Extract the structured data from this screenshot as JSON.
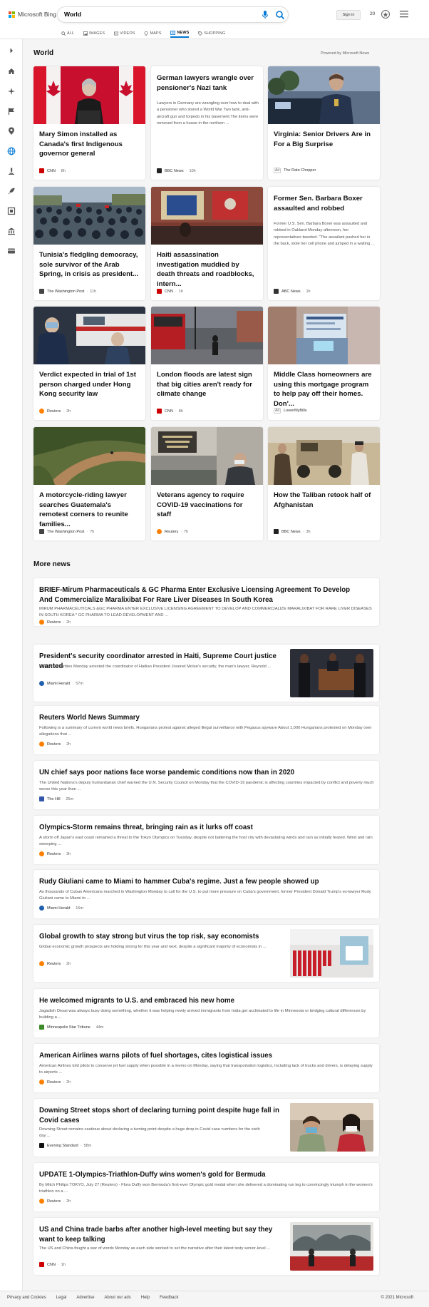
{
  "brand": {
    "name": "Microsoft Bing",
    "colors": [
      "#f25022",
      "#7fba00",
      "#00a4ef",
      "#ffb900"
    ]
  },
  "search": {
    "query": "World"
  },
  "header": {
    "sign_in": "Sign in",
    "points": "20"
  },
  "nav": [
    {
      "label": "ALL",
      "icon": "search-icon"
    },
    {
      "label": "IMAGES",
      "icon": "image-icon"
    },
    {
      "label": "VIDEOS",
      "icon": "video-icon"
    },
    {
      "label": "MAPS",
      "icon": "map-pin-icon"
    },
    {
      "label": "NEWS",
      "icon": "news-icon",
      "active": true
    },
    {
      "label": "SHOPPING",
      "icon": "tag-icon"
    }
  ],
  "main": {
    "title": "World",
    "powered": "Powered by Microsoft News"
  },
  "cards": [
    {
      "title": "Mary Simon installed as Canada's first Indigenous governor general",
      "source": "CNN",
      "time": "8h",
      "logo": "#cc0000",
      "img": "canada"
    },
    {
      "title": "German lawyers wrangle over pensioner's Nazi tank",
      "snippet": "Lawyers in Germany are wrangling over how to deal with a pensioner who stored a World War Two tank, anti-aircraft gun and torpedo in his basement.The items were removed from a house in the northern ...",
      "source": "BBC News",
      "time": "10h",
      "logo": "#222222"
    },
    {
      "title": "Virginia: Senior Drivers Are in For a Big Surprise",
      "source": "The Rate Chopper",
      "ad": "Ad",
      "img": "police"
    },
    {
      "title": "Tunisia's fledgling democracy, sole survivor of the Arab Spring, in crisis as president...",
      "source": "The Washington Post",
      "time": "11h",
      "logo": "#444444",
      "img": "crowd"
    },
    {
      "title": "Haiti assassination investigation muddied by death threats and roadblocks, intern...",
      "source": "CNN",
      "time": "1h",
      "logo": "#cc0000",
      "img": "haiti"
    },
    {
      "title": "Former Sen. Barbara Boxer assaulted and robbed",
      "snippet": "Former U.S. Sen. Barbara Boxer was assaulted and robbed in Oakland Monday afternoon, her representatives tweeted. \"The assailant pushed her in the back, stole her cell phone and jumped in a waiting ...",
      "source": "ABC News",
      "time": "1h",
      "logo": "#333333"
    },
    {
      "title": "Verdict expected in trial of 1st person charged under Hong Kong security law",
      "source": "Reuters",
      "time": "2h",
      "logo": "#ff8000",
      "img": "hongkong"
    },
    {
      "title": "London floods are latest sign that big cities aren't ready for climate change",
      "source": "CNN",
      "time": "8h",
      "logo": "#cc0000",
      "img": "london"
    },
    {
      "title": "Middle Class homeowners are using this mortgage program to help pay off their homes. Don'...",
      "source": "LowerMyBills",
      "ad": "Ad",
      "img": "mortgage"
    },
    {
      "title": "A motorcycle-riding lawyer searches Guatemala's remotest corners to reunite families...",
      "source": "The Washington Post",
      "time": "7h",
      "logo": "#444444",
      "img": "guatemala"
    },
    {
      "title": "Veterans agency to require COVID-19 vaccinations for staff",
      "source": "Reuters",
      "time": "7h",
      "logo": "#ff8000",
      "img": "veterans"
    },
    {
      "title": "How the Taliban retook half of Afghanistan",
      "source": "BBC News",
      "time": "3h",
      "logo": "#222222",
      "img": "taliban"
    }
  ],
  "more": {
    "title": "More news",
    "items": [
      {
        "title": "BRIEF-Mirum Pharmaceuticals & GC Pharma Enter Exclusive Licensing Agreement To Develop And Commercialize Maralixibat For Rare Liver Diseases In South Korea",
        "snippet": "MIRUM PHARMACEUTICALS &GC PHARMA ENTER EXCLUSIVE LICENSING AGREEMENT TO DEVELOP AND COMMERCIALIZE MARALIXIBAT FOR RARE LIVER DISEASES IN SOUTH KOREA * GC PHARMA TO LEAD DEVELOPMENT AND ...",
        "source": "Reuters",
        "time": "2h",
        "logo": "#ff8000"
      },
      {
        "title": "President's security coordinator arrested in Haiti, Supreme Court justice wanted",
        "snippet": "Haitian authorities Monday arrested the coordinator of Haitian President Jovenel Moïse's security, the man's lawyer, Reynold ...",
        "source": "Miami Herald",
        "time": "57m",
        "logo": "#1f5fad",
        "img": "coffin"
      },
      {
        "title": "Reuters World News Summary",
        "snippet": "Following is a summary of current world news briefs. Hungarians protest against alleged illegal surveillance with Pegasus spyware About 1,000 Hungarians protested on Monday over allegations that ...",
        "source": "Reuters",
        "time": "2h",
        "logo": "#ff8000"
      },
      {
        "title": "UN chief says poor nations face worse pandemic conditions now than in 2020",
        "snippet": "The United Nations's deputy humanitarian chief warned the U.N. Security Council on Monday that the COVID-19 pandemic is affecting countries impacted by conflict and poverty much worse this year than ...",
        "source": "The Hill",
        "time": "25m",
        "logo": "#3355aa"
      },
      {
        "title": "Olympics-Storm remains threat, bringing rain as it lurks off coast",
        "snippet": "A storm off Japan's east coast remained a threat to the Tokyo Olympics on Tuesday, despite not battering the host city with devastating winds and rain as initially feared. Wind and rain sweeping ...",
        "source": "Reuters",
        "time": "3h",
        "logo": "#ff8000"
      },
      {
        "title": "Rudy Giuliani came to Miami to hammer Cuba's regime. Just a few people showed up",
        "snippet": "As thousands of Cuban Americans marched in Washington Monday to call for the U.S. to put more pressure on Cuba's government, former President Donald Trump's ex-lawyer Rudy Giuliani came to Miami to ...",
        "source": "Miami Herald",
        "time": "16m",
        "logo": "#1f5fad"
      },
      {
        "title": "Global growth to stay strong but virus the top risk, say economists",
        "snippet": "Global economic growth prospects are holding strong for this year and next, despite a significant majority of economists in ...",
        "source": "Reuters",
        "time": "2h",
        "logo": "#ff8000",
        "img": "vials"
      },
      {
        "title": "He welcomed migrants to U.S. and embraced his new home",
        "snippet": "Jagadish Desai was always busy doing something, whether it was helping newly arrived immigrants from India get acclimated to life in Minnesota or bridging cultural differences by building a ...",
        "source": "Minneapolis Star Tribune",
        "time": "44m",
        "logo": "#3a8a2a"
      },
      {
        "title": "American Airlines warns pilots of fuel shortages, cites logistical issues",
        "snippet": "American Airlines told pilots to conserve jet fuel supply when possible in a memo on Monday, saying that transportation logistics, including lack of trucks and drivers, is delaying supply to airports ...",
        "source": "Reuters",
        "time": "2h",
        "logo": "#ff8000"
      },
      {
        "title": "Downing Street stops short of declaring turning point despite huge fall in Covid cases",
        "snippet": "Downing Street remains cautious about declaring a turning point despite a huge drop in Covid case numbers for the sixth day ...",
        "source": "Evening Standard",
        "time": "58m",
        "logo": "#111111",
        "img": "masks"
      },
      {
        "title": "UPDATE 1-Olympics-Triathlon-Duffy wins women's gold for Bermuda",
        "snippet": "By Mitch Philips TOKYO, July 27 (Reuters) - Flora Duffy won Bermuda's first-ever Olympic gold medal when she delivered a dominating run leg to convincingly triumph in the women's triathlon on a ...",
        "source": "Reuters",
        "time": "2h",
        "logo": "#ff8000"
      },
      {
        "title": "US and China trade barbs after another high-level meeting but say they want to keep talking",
        "snippet": "The US and China fought a war of words Monday as each side worked to set the narrative after their latest testy senior-level ...",
        "source": "CNN",
        "time": "1h",
        "logo": "#cc0000",
        "img": "china"
      }
    ]
  },
  "footer": {
    "links": [
      "Privacy and Cookies",
      "Legal",
      "Advertise",
      "About our ads",
      "Help",
      "Feedback"
    ],
    "copyright": "© 2021 Microsoft"
  }
}
